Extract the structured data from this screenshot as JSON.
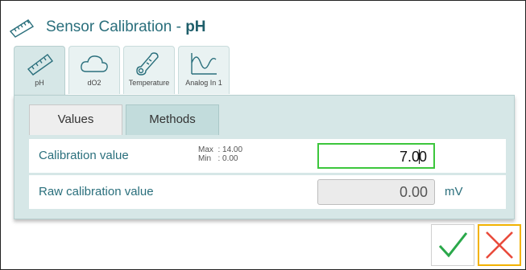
{
  "title": {
    "prefix": "Sensor Calibration - ",
    "sensor": "pH"
  },
  "sensor_tabs": [
    {
      "label": "pH",
      "icon": "ruler-icon",
      "active": true
    },
    {
      "label": "dO2",
      "icon": "cloud-icon",
      "active": false
    },
    {
      "label": "Temperature",
      "icon": "thermometer-icon",
      "active": false
    },
    {
      "label": "Analog In 1",
      "icon": "waveform-icon",
      "active": false
    }
  ],
  "sub_tabs": {
    "values": "Values",
    "methods": "Methods"
  },
  "rows": {
    "calibration": {
      "label": "Calibration value",
      "max": "Max  : 14.00",
      "min": "Min   : 0.00",
      "value_before_caret": "7.0",
      "value_after_caret": "0"
    },
    "raw": {
      "label": "Raw calibration value",
      "value": "0.00",
      "unit": "mV"
    }
  },
  "colors": {
    "accent": "#2a6f7c",
    "panel": "#d6e7e7",
    "confirm": "#2aa84a",
    "cancel": "#e94b3c",
    "focus": "#3cc63c"
  }
}
